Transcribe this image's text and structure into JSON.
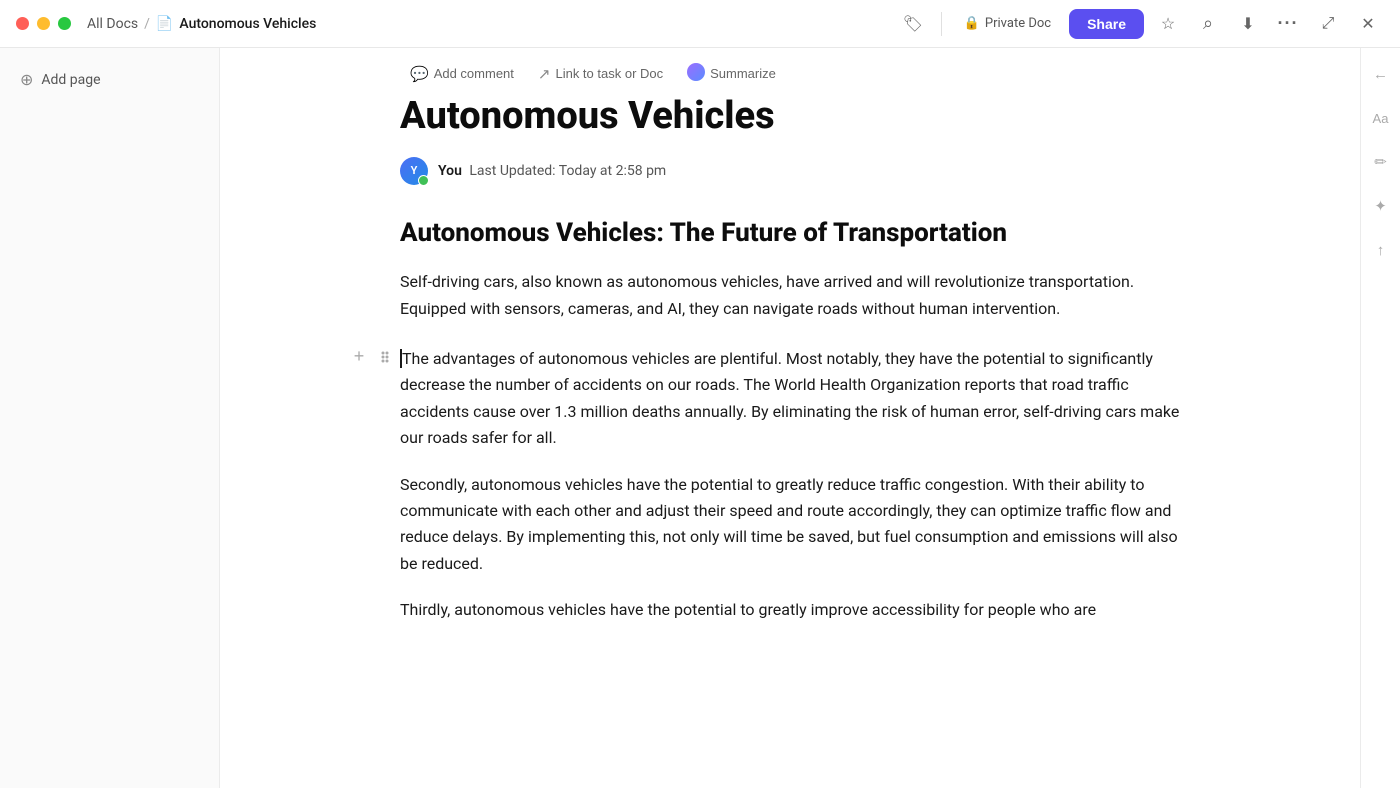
{
  "titlebar": {
    "all_docs_label": "All Docs",
    "separator": "/",
    "doc_title": "Autonomous Vehicles",
    "private_doc_label": "Private Doc",
    "share_label": "Share"
  },
  "sidebar": {
    "add_page_label": "Add page"
  },
  "toolbar": {
    "add_comment_label": "Add comment",
    "link_task_label": "Link to task or Doc",
    "summarize_label": "Summarize"
  },
  "document": {
    "title": "Autonomous Vehicles",
    "author": "You",
    "last_updated": "Last Updated: Today at 2:58 pm",
    "heading": "Autonomous Vehicles: The Future of Transportation",
    "paragraph1": "Self-driving cars, also known as autonomous vehicles, have arrived and will revolutionize transportation. Equipped with sensors, cameras, and AI, they can navigate roads without human intervention.",
    "paragraph2": "The advantages of autonomous vehicles are plentiful. Most notably, they have the potential to significantly decrease the number of accidents on our roads. The World Health Organization reports that road traffic accidents cause over 1.3 million deaths annually. By eliminating the risk of human error, self-driving cars make our roads safer for all.",
    "paragraph3": "Secondly, autonomous vehicles have the potential to greatly reduce traffic congestion. With their ability to communicate with each other and adjust their speed and route accordingly, they can optimize traffic flow and reduce delays. By implementing this, not only will time be saved, but fuel consumption and emissions will also be reduced.",
    "paragraph4": "Thirdly, autonomous vehicles have the potential to greatly improve accessibility for people who are"
  },
  "icons": {
    "add_page": "⊕",
    "add_comment": "💬",
    "link": "↗",
    "star": "☆",
    "search": "⌕",
    "export": "↓",
    "more": "···",
    "fullscreen": "⤢",
    "close": "✕",
    "lock": "🔒",
    "tag": "🏷",
    "collapse": "←",
    "font": "Aa",
    "paint": "✏",
    "sparkle": "✦",
    "share_up": "↑"
  }
}
